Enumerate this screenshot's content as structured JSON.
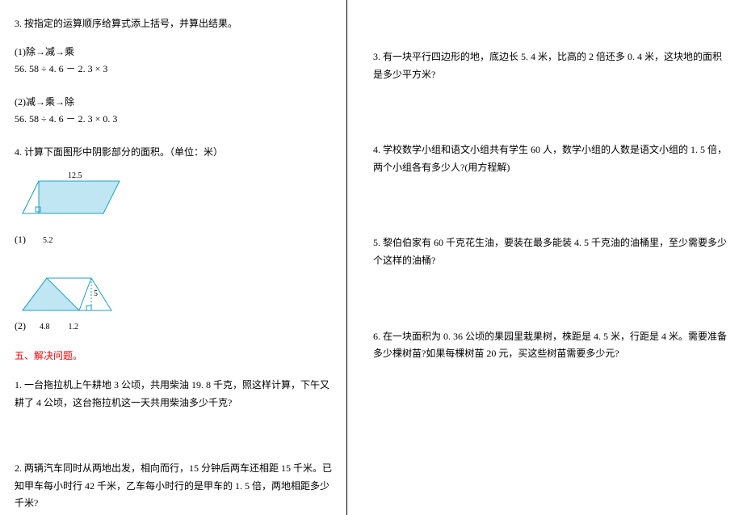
{
  "left": {
    "q3_title": "3. 按指定的运算顺序给算式添上括号，并算出结果。",
    "q3_1_rule": "(1)除→减→乘",
    "q3_1_expr": "56. 58 ÷ 4. 6 － 2. 3 × 3",
    "q3_2_rule": "(2)减→乘→除",
    "q3_2_expr": "56. 58 ÷ 4. 6 － 2. 3 × 0. 3",
    "q4_title": "4. 计算下面图形中阴影部分的面积。（单位：米）",
    "fig1_top": "12.5",
    "fig1_bottom": "5.2",
    "fig1_label": "(1)",
    "fig2_left": "4.8",
    "fig2_mid": "1.2",
    "fig2_height": "5",
    "fig2_label": "(2)",
    "section5": "五、解决问题。",
    "s5q1": "1. 一台拖拉机上午耕地 3 公顷，共用柴油 19. 8 千克，照这样计算，下午又耕了 4 公顷，这台拖拉机这一天共用柴油多少千克?",
    "s5q2": "2. 两辆汽车同时从两地出发，相向而行，15 分钟后两车还相距 15 千米。已知甲车每小时行 42 千米，乙车每小时行的是甲车的 1. 5 倍，两地相距多少千米?"
  },
  "right": {
    "q3": "3. 有一块平行四边形的地，底边长 5. 4 米，比高的 2 倍还多 0. 4 米，这块地的面积是多少平方米?",
    "q4": "4. 学校数学小组和语文小组共有学生 60 人，数学小组的人数是语文小组的 1. 5 倍，两个小组各有多少人?(用方程解)",
    "q5": "5. 黎伯伯家有 60 千克花生油，要装在最多能装 4. 5 千克油的油桶里，至少需要多少个这样的油桶?",
    "q6": "6. 在一块面积为 0. 36 公顷的果园里栽果树，株距是 4. 5 米，行距是 4 米。需要准备多少棵树苗?如果每棵树苗 20 元，买这些树苗需要多少元?"
  },
  "chart_data": [
    {
      "type": "diagram",
      "description": "Parallelogram shaded minus small triangle at bottom-left",
      "top_side": 12.5,
      "bottom_segment": 5.2,
      "unit": "米"
    },
    {
      "type": "diagram",
      "description": "Trapezoid with shaded triangle on left portion",
      "left_base": 4.8,
      "right_remainder": 1.2,
      "height": 5,
      "unit": "米"
    }
  ]
}
